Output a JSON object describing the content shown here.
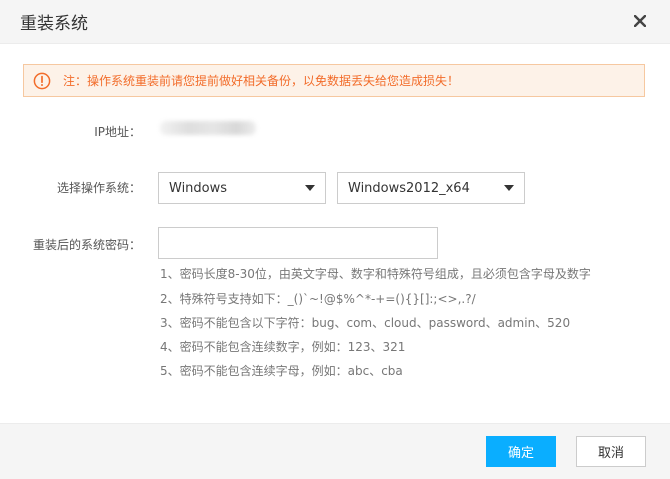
{
  "dialog": {
    "title": "重装系统"
  },
  "warning": {
    "text": "注：操作系统重装前请您提前做好相关备份，以免数据丢失给您造成损失！",
    "color": "#f26c2a"
  },
  "form": {
    "ip_label": "IP地址：",
    "os_label": "选择操作系统：",
    "os_family": "Windows",
    "os_version": "Windows2012_x64",
    "password_label": "重装后的系统密码：",
    "password_value": "",
    "rules": [
      "1、密码长度8-30位，由英文字母、数字和特殊符号组成，且必须包含字母及数字",
      "2、特殊符号支持如下：_()`~!@$%^*-+=(){}[]:;<>,.?/",
      "3、密码不能包含以下字符：bug、com、cloud、password、admin、520",
      "4、密码不能包含连续数字，例如：123、321",
      "5、密码不能包含连续字母，例如：abc、cba"
    ]
  },
  "footer": {
    "confirm_label": "确定",
    "cancel_label": "取消"
  },
  "colors": {
    "primary": "#0aaeff",
    "warning_bg": "#fdf2e8"
  },
  "icons": {
    "close": "close-icon",
    "warning": "warning-circle-icon",
    "dropdown": "caret-down-icon"
  }
}
